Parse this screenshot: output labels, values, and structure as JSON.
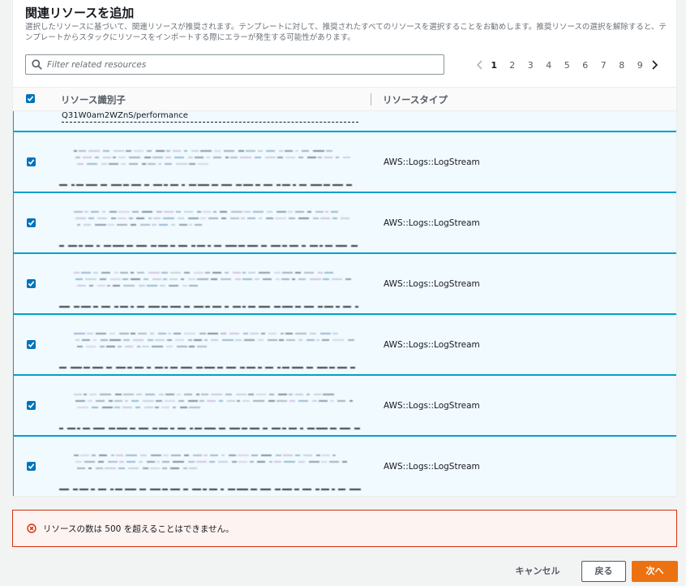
{
  "section": {
    "title": "関連リソースを追加",
    "description": "選択したリソースに基づいて、関連リソースが推奨されます。テンプレートに対して、推奨されたすべてのリソースを選択することをお勧めします。推奨リソースの選択を解除すると、テンプレートからスタックにリソースをインポートする際にエラーが発生する可能性があります。"
  },
  "search": {
    "placeholder": "Filter related resources",
    "value": ""
  },
  "pagination": {
    "pages": [
      "1",
      "2",
      "3",
      "4",
      "5",
      "6",
      "7",
      "8",
      "9"
    ],
    "current": "1"
  },
  "table": {
    "headers": {
      "identifier": "リソース識別子",
      "type": "リソースタイプ"
    },
    "partial_row_identifier": "Q31W0am2WZnS/performance",
    "rows": [
      {
        "selected": true,
        "identifier": "",
        "type": "AWS::Logs::LogStream"
      },
      {
        "selected": true,
        "identifier": "",
        "type": "AWS::Logs::LogStream"
      },
      {
        "selected": true,
        "identifier": "",
        "type": "AWS::Logs::LogStream"
      },
      {
        "selected": true,
        "identifier": "",
        "type": "AWS::Logs::LogStream"
      },
      {
        "selected": true,
        "identifier": "",
        "type": "AWS::Logs::LogStream"
      },
      {
        "selected": true,
        "identifier": "",
        "type": "AWS::Logs::LogStream"
      }
    ]
  },
  "error": {
    "icon": "error-circle-icon",
    "message": "リソースの数は 500 を超えることはできません。"
  },
  "footer": {
    "cancel": "キャンセル",
    "back": "戻る",
    "next": "次へ"
  },
  "colors": {
    "accent": "#0073bb",
    "selected_row_bg": "#f1faff",
    "selected_row_border": "#00a1c9",
    "error_border": "#d13212",
    "primary_button": "#ec7211"
  }
}
